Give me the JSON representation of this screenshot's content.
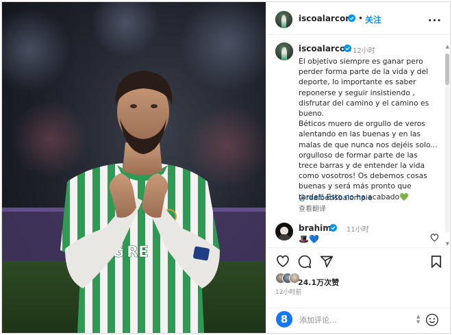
{
  "header": {
    "username": "iscoalarcon",
    "dot": "•",
    "follow_label": "关注",
    "more_label": "..."
  },
  "caption": {
    "username": "iscoalarcon",
    "time": "12小时",
    "text": "El objetivo siempre es ganar pero\nperder forma parte de la vida y del\ndeporte, lo importante es saber\nreponerse y seguir insistiendo ,\ndisfrutar del camino y el camino es\nbueno.\nBéticos muero de orgullo de veros\nalentando en las buenas y en las\nmalas de que nunca nos dejéis solo...\norgulloso de formar parte de las\ntrece barras y de entender la vida\ncomo vosotros! Os debemos cosas\nbuenas y será más pronto que\ntarde!! Esto no ha acabado",
    "heart_emoji": "💚",
    "mention": "@realbetisbalompie",
    "translate_label": "查看翻译"
  },
  "comment": {
    "username": "brahim",
    "time": "11小时",
    "emojis": "🎩💙"
  },
  "actions": {
    "likes": "24.1万次赞",
    "post_time": "12小时前"
  },
  "add_comment": {
    "badge": "8",
    "placeholder": "添加评论..."
  },
  "colors": {
    "accent": "#0095f6",
    "verified": "#0095f6",
    "mention": "#00376b",
    "green_heart": "#4fc62f",
    "betis_green": "#2e9b55"
  },
  "icons": [
    "verified-icon",
    "more-icon",
    "heart-icon",
    "comment-icon",
    "share-icon",
    "bookmark-icon",
    "emoji-icon",
    "scroll-up-icon",
    "scroll-down-icon"
  ]
}
